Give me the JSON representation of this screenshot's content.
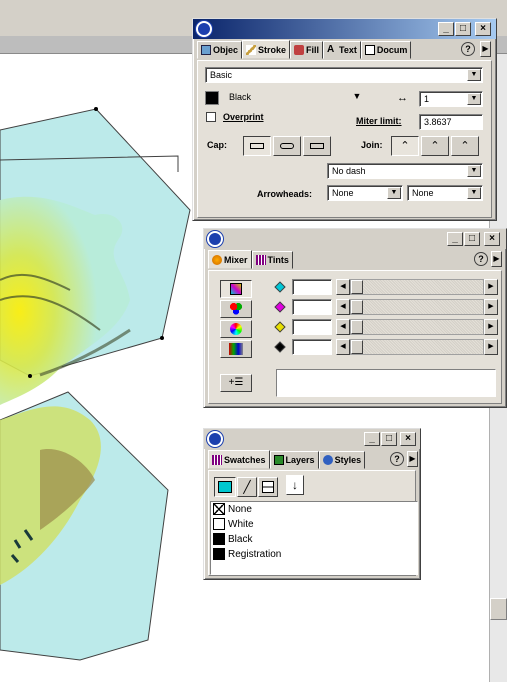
{
  "stroke_panel": {
    "tabs": [
      "Objec",
      "Stroke",
      "Fill",
      "Text",
      "Docum"
    ],
    "help": "?",
    "stroke_type": "Basic",
    "color": "Black",
    "width": "1",
    "overprint": "Overprint",
    "miter_label": "Miter limit:",
    "miter_value": "3.8637",
    "cap_label": "Cap:",
    "join_label": "Join:",
    "dash": "No dash",
    "arrowheads_label": "Arrowheads:",
    "arrow_start": "None",
    "arrow_end": "None",
    "colors": {
      "color_swatch": "#000000"
    }
  },
  "mixer_panel": {
    "tabs": [
      "Mixer",
      "Tints"
    ],
    "help": "?",
    "channels": [
      {
        "value": "",
        "color": "#00c8d8"
      },
      {
        "value": "",
        "color": "#e000e0"
      },
      {
        "value": "",
        "color": "#e8e000"
      },
      {
        "value": "",
        "color": "#000000"
      }
    ]
  },
  "swatches_panel": {
    "tabs": [
      "Swatches",
      "Layers",
      "Styles"
    ],
    "help": "?",
    "items": [
      {
        "name": "None",
        "color": "none"
      },
      {
        "name": "White",
        "color": "#ffffff"
      },
      {
        "name": "Black",
        "color": "#000000"
      },
      {
        "name": "Registration",
        "color": "#000000"
      }
    ]
  },
  "window_buttons": {
    "minimize": "_",
    "maximize": "□",
    "close": "×"
  }
}
